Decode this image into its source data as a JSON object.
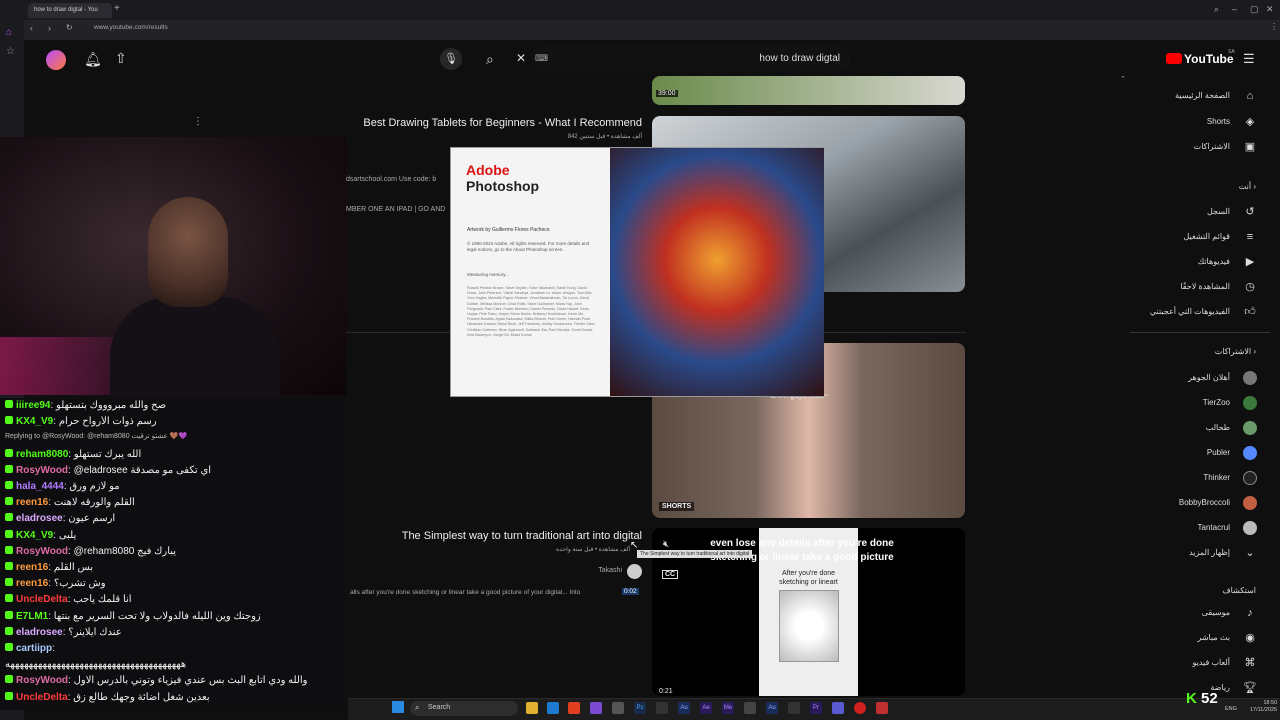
{
  "browser": {
    "tab_title": "how to draw digtal - You",
    "url": "www.youtube.com/results"
  },
  "header": {
    "search_query": "how to draw digtal",
    "logo_text": "YouTube",
    "logo_country": "SA"
  },
  "results": {
    "top_duration": "39:00",
    "r1_title": "Best Drawing Tablets for Beginners - What I Recommend",
    "r1_meta": "842 ألف مشاهدة • قبل سنتين",
    "r1_desc_fragment": "dsartschool.com Use code: b",
    "r1_desc_fragment2": "MBER ONE AN IPAD | GO AND",
    "shorts_label": "SHORTS",
    "short_overlay": "umm guys wait~",
    "r2_title": "The Simplest way to turn traditional art into digital",
    "r2_meta": "ألف مشاهدة • قبل سنة واحدة",
    "r2_channel": "Takashi",
    "r2_desc": "alls after you're done sketching or linear take a good picture of your digital... Into",
    "r2_chapter": "0:02",
    "r2_caption_1": "even lose any details after you're done",
    "r2_caption_2": "sketching or linear take a good picture",
    "r2_thumb_text_1": "After you're done",
    "r2_thumb_text_2": "sketching or lineart",
    "r2_duration": "0:21",
    "r2_cc": "CC",
    "tooltip": "The Simplest way to turn traditional art into digital"
  },
  "photoshop": {
    "brand": "Adobe",
    "product": "Photoshop",
    "artwork": "Artwork by Guillermo Flores Pacheco",
    "copyright": "© 1990-2024 Adobe. All rights reserved. For more details and legal notices, go to the About Photoshop screen.",
    "status": "Measuring memory...",
    "credits": "Russell Preston Brown, Steve Snyder, Yukie Takahashi, Sarah Kong, David Howe, John Peterson, Vishal Sandhya, Jonathan Lo, Adam Jerugim, Tom Attix, Yuko Kagita, Meredith Payne Stotzner, Vinod Balakrishnan, Tai Luxon, David Dobish, Melissa Monroe, Chad Rolfs, Steve Guilhamet, Maria Yap, John Fitzgerald, Pam Clark, Foster Brereton, Daniel Presedo, David Hackel, Kevin Hopps, Pete Falco, Jesper Storm Bache, Brittany Hendrickson, Kevin Mo, Praneet Bunditla, Agata Sadowska, Nikita Bhanot, Pete Green, Hannah Pearl, Himanshu Kataria, Rahul Bisht, Jeff Tranberry, Ashley Souzarman, Frieder Ganz, Christian Gutierrez, Brian Agaranoff, Subhash Jha, Paul Kleczka, Sumit Kumar, Irina Maderych, Yangli Shi, Mukul Kumar"
  },
  "nav": {
    "home": "الصفحة الرئيسية",
    "shorts": "Shorts",
    "subscriptions": "الاشتراكات",
    "you": "أنت",
    "history": "السجل",
    "playlists": "قوائم التشغيل",
    "your_videos": "فيديوهاتك",
    "watch_later": "المشاهدة لاحقًا",
    "liked": "الفيديوهات التي أعجبتني",
    "subs_header": "الاشتراكات",
    "channels": [
      "أهلان الجوهر",
      "TierZoo",
      "طحالب",
      "Publer",
      "Thinker",
      "BobbyBroccoli",
      "Tantacrul"
    ],
    "show_more": "إظهار المزيد",
    "explore": "استكشاف",
    "music": "موسيقى",
    "live": "بث مباشر",
    "gaming": "ألعاب فيديو",
    "sports": "رياضة"
  },
  "chat": [
    {
      "user": "iiiree94",
      "color": "#53fc18",
      "text": "صح والله مبروووك بتستهلو"
    },
    {
      "user": "KX4_V9",
      "color": "#53fc18",
      "text": "رسم ذوات الأرواح حرام"
    },
    {
      "reply": "Replying to @RosyWood: @reham8080 عشتو ترقيت 🤎💜"
    },
    {
      "user": "reham8080",
      "color": "#53fc18",
      "text": "الله يبرك تستهلو"
    },
    {
      "user": "RosyWood",
      "color": "#e06ba3",
      "text": "@eladrosee اي تكفى مو مصدقة"
    },
    {
      "user": "hala_4444",
      "color": "#b07cff",
      "text": "مو لازم ورق"
    },
    {
      "user": "reen16",
      "color": "#ff9a3c",
      "text": "القلم والورقه لاهنت"
    },
    {
      "user": "eladrosee",
      "color": "#d9a8ff",
      "text": "ارسم عيون"
    },
    {
      "user": "KX4_V9",
      "color": "#53fc18",
      "text": "يلبى"
    },
    {
      "user": "RosyWood",
      "color": "#e06ba3",
      "text": "@reham8080 يبارك فيج"
    },
    {
      "user": "reen16",
      "color": "#ff9a3c",
      "text": "بس القلم"
    },
    {
      "user": "reen16",
      "color": "#ff9a3c",
      "text": "وش تشرب؟"
    },
    {
      "user": "UncleDelta",
      "color": "#ff3b3b",
      "text": "انا قلمك ياحب"
    },
    {
      "user": "E7LM1",
      "color": "#53fc18",
      "text": "زوجتك وين الليله فالدولاب ولا تحت السرير مع بنتها"
    },
    {
      "user": "eladrosee",
      "color": "#d9a8ff",
      "text": "عندك ايلاينر؟"
    },
    {
      "user": "cartiipp",
      "color": "#a8c8ff",
      "text": ""
    },
    {
      "user": "",
      "color": "#eee",
      "text": "ههههههههههههههههههههههههههههههههههههههه"
    },
    {
      "user": "RosyWood",
      "color": "#e06ba3",
      "text": "والله ودي اتابع البث بس عندي فيزياء وتوني بالدرس الاول"
    },
    {
      "user": "UncleDelta",
      "color": "#ff3b3b",
      "text": "بعدين شغل اضائة وجهك طالع زق"
    }
  ],
  "taskbar": {
    "search": "Search",
    "viewer_count": "52",
    "lang": "ENG",
    "time": "18:50",
    "date": "17/11/2025"
  }
}
